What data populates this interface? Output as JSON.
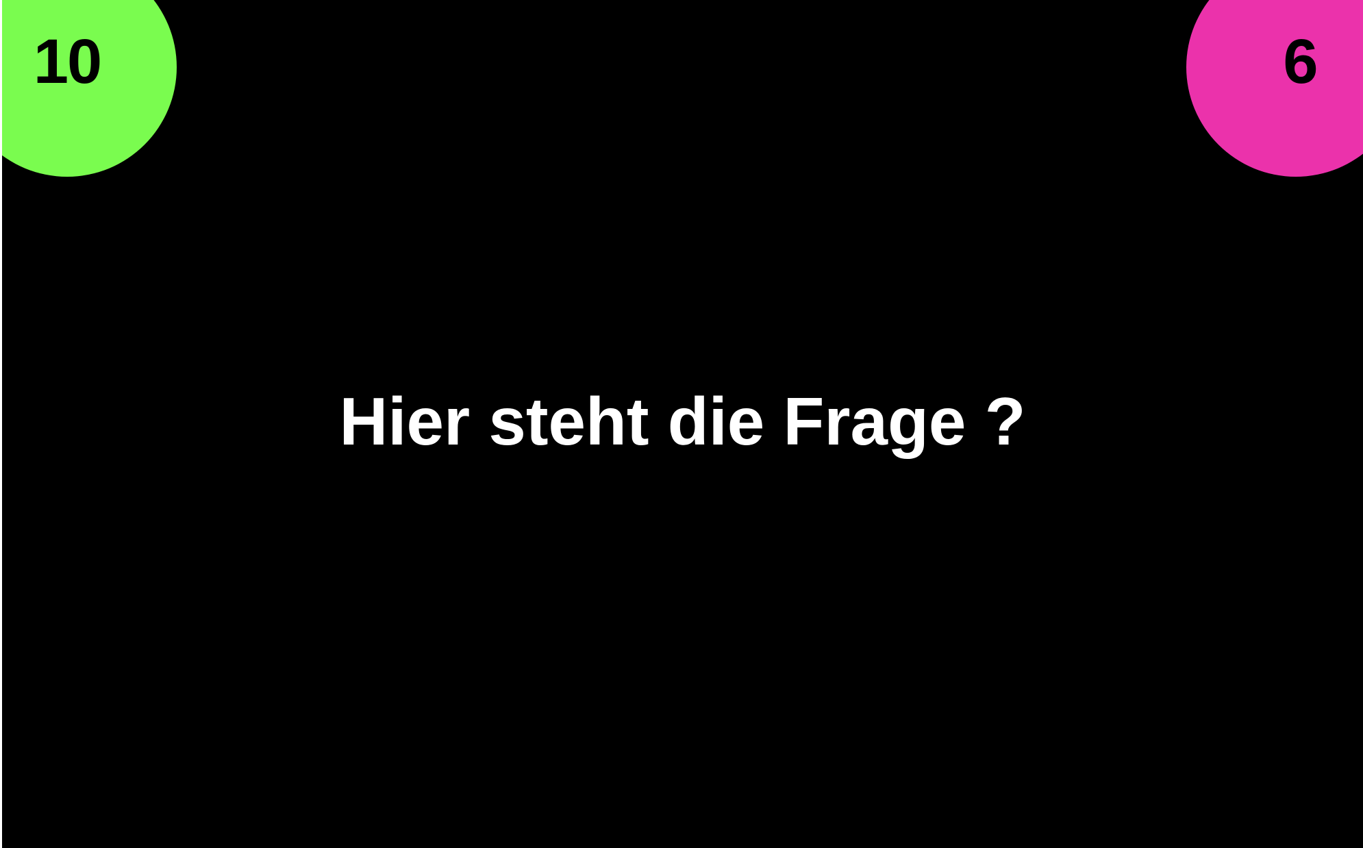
{
  "scores": {
    "left": {
      "value": "10",
      "color": "#7afc4f"
    },
    "right": {
      "value": "6",
      "color": "#eb32ab"
    }
  },
  "question": {
    "text": "Hier steht die Frage ?"
  },
  "colors": {
    "background": "#000000",
    "text": "#ffffff",
    "score_text": "#000000"
  }
}
